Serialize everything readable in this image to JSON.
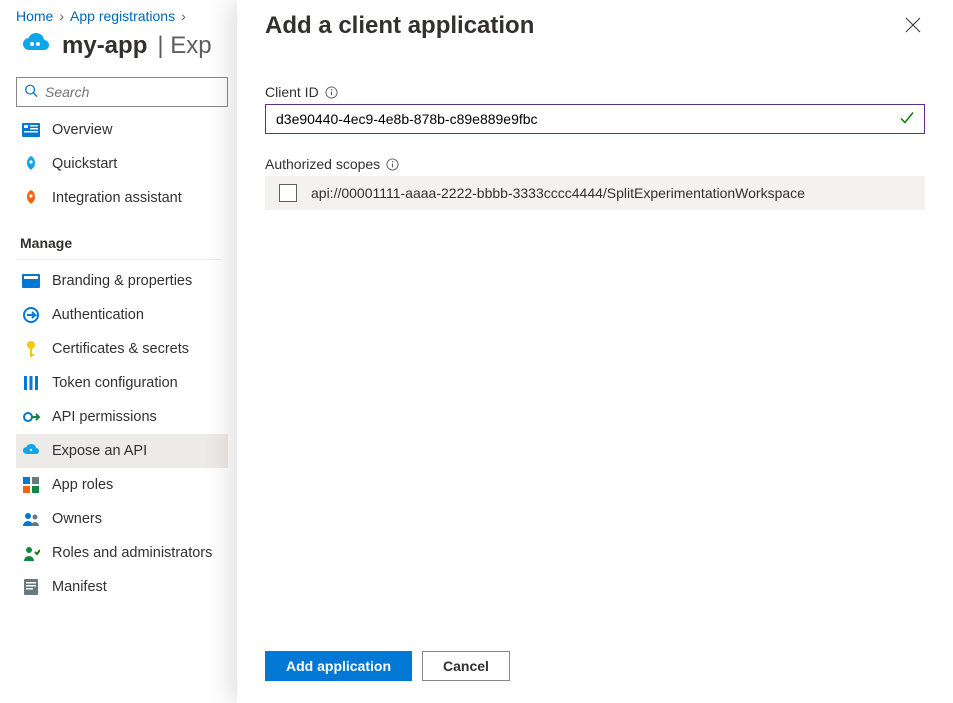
{
  "breadcrumb": {
    "items": [
      {
        "label": "Home"
      },
      {
        "label": "App registrations"
      }
    ]
  },
  "page": {
    "app_name": "my-app",
    "suffix": " | Exp"
  },
  "search": {
    "placeholder": "Search"
  },
  "nav_top": [
    {
      "label": "Overview",
      "icon": "overview-icon"
    },
    {
      "label": "Quickstart",
      "icon": "quickstart-icon"
    },
    {
      "label": "Integration assistant",
      "icon": "rocket-icon"
    }
  ],
  "manage": {
    "title": "Manage",
    "items": [
      {
        "label": "Branding & properties",
        "icon": "branding-icon"
      },
      {
        "label": "Authentication",
        "icon": "auth-icon"
      },
      {
        "label": "Certificates & secrets",
        "icon": "key-icon"
      },
      {
        "label": "Token configuration",
        "icon": "token-icon"
      },
      {
        "label": "API permissions",
        "icon": "api-perm-icon"
      },
      {
        "label": "Expose an API",
        "icon": "expose-icon",
        "selected": true
      },
      {
        "label": "App roles",
        "icon": "approles-icon"
      },
      {
        "label": "Owners",
        "icon": "owners-icon"
      },
      {
        "label": "Roles and administrators",
        "icon": "roles-icon"
      },
      {
        "label": "Manifest",
        "icon": "manifest-icon"
      }
    ]
  },
  "panel": {
    "title": "Add a client application",
    "client_id": {
      "label": "Client ID",
      "value": "d3e90440-4ec9-4e8b-878b-c89e889e9fbc"
    },
    "scopes": {
      "label": "Authorized scopes",
      "items": [
        {
          "label": "api://00001111-aaaa-2222-bbbb-3333cccc4444/SplitExperimentationWorkspace",
          "checked": false
        }
      ]
    },
    "primary_button": "Add application",
    "secondary_button": "Cancel"
  },
  "icons": {
    "chevron": "›"
  }
}
